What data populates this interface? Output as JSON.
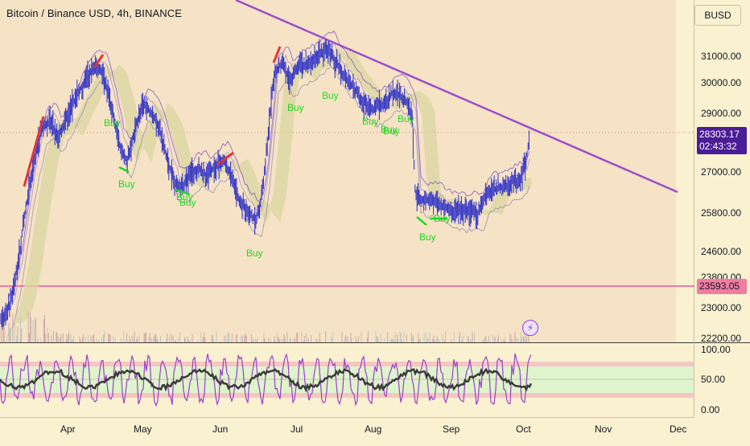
{
  "header": {
    "symbol_title": "Bitcoin / Binance USD, 4h, BINANCE",
    "currency_button": "BUSD"
  },
  "price_axis": {
    "labels": [
      "31000.00",
      "30000.00",
      "29000.00",
      "27000.00",
      "25800.00",
      "24600.00",
      "23800.00",
      "23000.00",
      "22200.00"
    ],
    "current_price": "28303.17",
    "countdown": "02:43:32",
    "horizontal_line_price": "23593.05"
  },
  "oscillator_axis": {
    "labels": [
      "100.00",
      "50.00",
      "0.00"
    ]
  },
  "time_axis": {
    "labels": [
      "Apr",
      "May",
      "Jun",
      "Jul",
      "Aug",
      "Sep",
      "Oct",
      "Nov",
      "Dec"
    ]
  },
  "signals": {
    "buy_label": "Buy"
  },
  "colors": {
    "background": "#faf1d1",
    "trendline": "#9a4dcc",
    "horizontal_line": "#f07ca2",
    "current_price_tag": "#4a1c96",
    "buy_text": "#22d622",
    "candles": "#2a2dc7",
    "oscillator_purple": "#9b3ec8"
  },
  "icons": {
    "alert_button": "lightning-icon"
  }
}
